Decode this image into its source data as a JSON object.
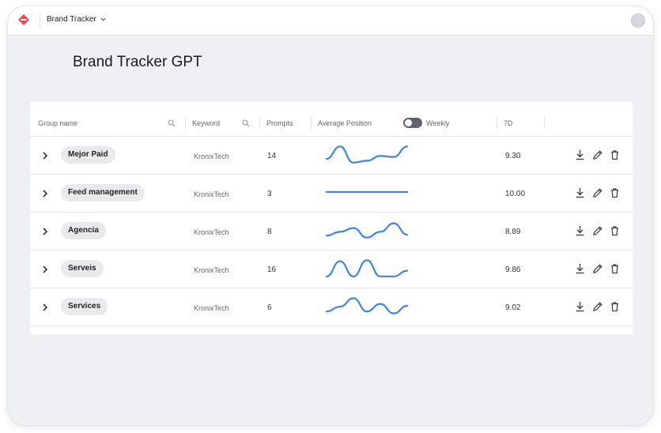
{
  "header": {
    "app_name": "Brand Tracker",
    "logo_icon": "brand-logo-icon",
    "accent": "#e8484f"
  },
  "page": {
    "title": "Brand Tracker GPT"
  },
  "table": {
    "columns": {
      "group": "Group name",
      "keyword": "Keyword",
      "prompts": "Prompts",
      "avg_position": "Average Position",
      "weekly_label": "Weekly",
      "period": "7D"
    },
    "weekly_toggle_on": false,
    "line_color": "#3d86e6",
    "rows": [
      {
        "group": "Mejor Paid",
        "keyword": "KronixTech",
        "prompts": "14",
        "value": "9.30",
        "trend": [
          0.25,
          0.9,
          0.05,
          0.15,
          0.4,
          0.35,
          0.9
        ]
      },
      {
        "group": "Feed management",
        "keyword": "KronixTech",
        "prompts": "3",
        "value": "10.00",
        "trend": [
          0.5,
          0.5,
          0.5,
          0.5,
          0.5,
          0.5,
          0.5
        ]
      },
      {
        "group": "Agencia",
        "keyword": "KronixTech",
        "prompts": "8",
        "value": "8.89",
        "trend": [
          0.2,
          0.4,
          0.6,
          0.1,
          0.4,
          0.85,
          0.25
        ]
      },
      {
        "group": "Serveis",
        "keyword": "KronixTech",
        "prompts": "16",
        "value": "9.86",
        "trend": [
          0.05,
          0.85,
          0.05,
          0.9,
          0.05,
          0.05,
          0.35
        ]
      },
      {
        "group": "Services",
        "keyword": "KronixTech",
        "prompts": "6",
        "value": "9.02",
        "trend": [
          0.2,
          0.45,
          0.9,
          0.2,
          0.6,
          0.1,
          0.5
        ]
      }
    ]
  }
}
